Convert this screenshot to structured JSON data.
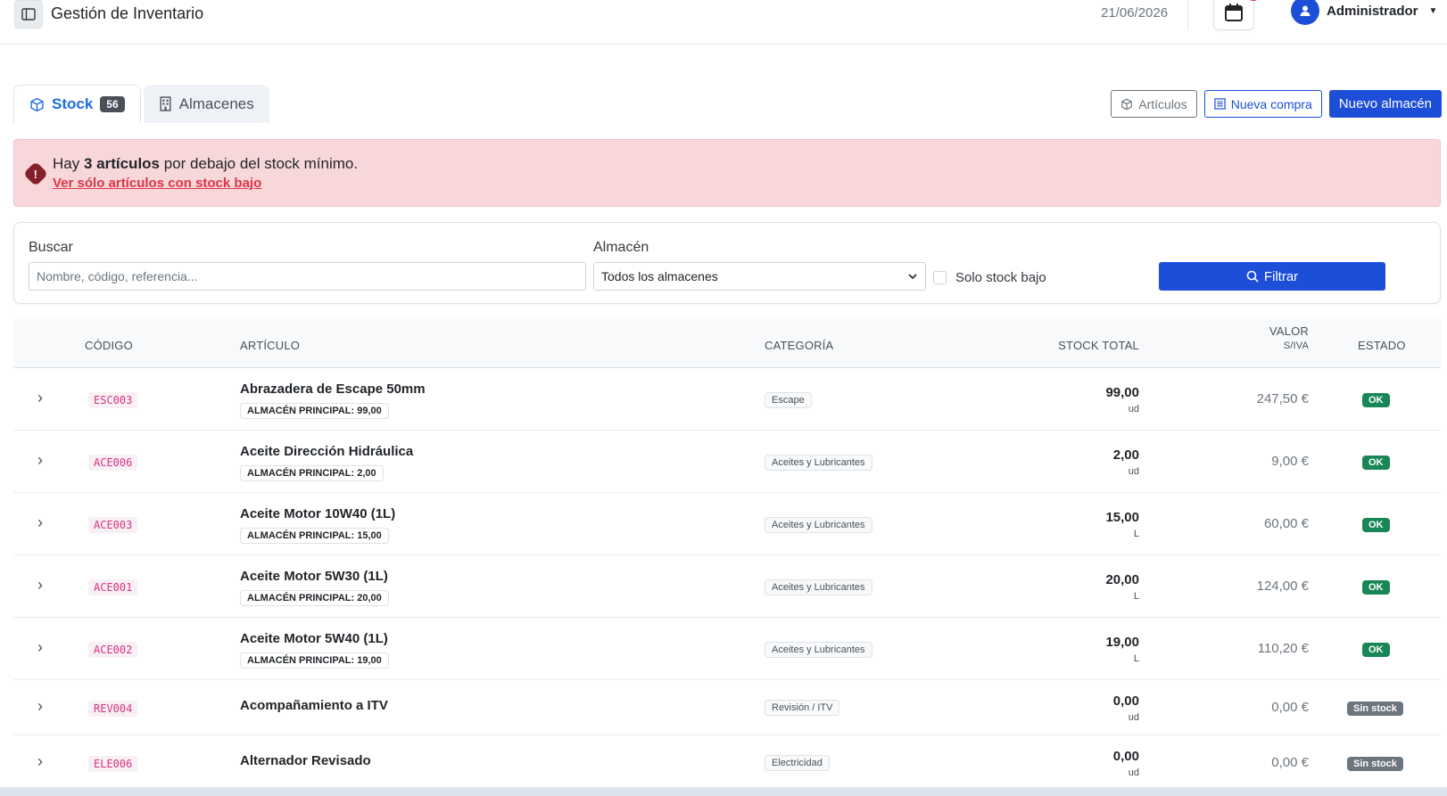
{
  "header": {
    "title": "Gestión de Inventario",
    "date": "21/06/2026",
    "user": "Administrador"
  },
  "tabs": [
    {
      "label": "Stock",
      "count": "56"
    },
    {
      "label": "Almacenes"
    }
  ],
  "actions": {
    "articulos": "Artículos",
    "nueva_compra": "Nueva compra",
    "nuevo_almacen": "Nuevo almacén"
  },
  "alert": {
    "prefix": "Hay",
    "bold": "3 artículos",
    "suffix": "por debajo del stock mínimo.",
    "link": "Ver sólo artículos con stock bajo"
  },
  "filters": {
    "search_label": "Buscar",
    "search_placeholder": "Nombre, código, referencia...",
    "warehouse_label": "Almacén",
    "warehouse_value": "Todos los almacenes",
    "low_stock_label": "Solo stock bajo",
    "filter_button": "Filtrar"
  },
  "table": {
    "columns": {
      "code": "CÓDIGO",
      "article": "ARTÍCULO",
      "category": "CATEGORÍA",
      "stock": "STOCK TOTAL",
      "value_line1": "VALOR",
      "value_line2": "S/IVA",
      "status": "ESTADO"
    },
    "rows": [
      {
        "code": "ESC003",
        "name": "Abrazadera de Escape 50mm",
        "warehouse": "ALMACÉN PRINCIPAL: 99,00",
        "category": "Escape",
        "stock": "99,00",
        "unit": "ud",
        "value": "247,50 €",
        "status": "OK"
      },
      {
        "code": "ACE006",
        "name": "Aceite Dirección Hidráulica",
        "warehouse": "ALMACÉN PRINCIPAL: 2,00",
        "category": "Aceites y Lubricantes",
        "stock": "2,00",
        "unit": "ud",
        "value": "9,00 €",
        "status": "OK"
      },
      {
        "code": "ACE003",
        "name": "Aceite Motor 10W40 (1L)",
        "warehouse": "ALMACÉN PRINCIPAL: 15,00",
        "category": "Aceites y Lubricantes",
        "stock": "15,00",
        "unit": "L",
        "value": "60,00 €",
        "status": "OK"
      },
      {
        "code": "ACE001",
        "name": "Aceite Motor 5W30 (1L)",
        "warehouse": "ALMACÉN PRINCIPAL: 20,00",
        "category": "Aceites y Lubricantes",
        "stock": "20,00",
        "unit": "L",
        "value": "124,00 €",
        "status": "OK"
      },
      {
        "code": "ACE002",
        "name": "Aceite Motor 5W40 (1L)",
        "warehouse": "ALMACÉN PRINCIPAL: 19,00",
        "category": "Aceites y Lubricantes",
        "stock": "19,00",
        "unit": "L",
        "value": "110,20 €",
        "status": "OK"
      },
      {
        "code": "REV004",
        "name": "Acompañamiento a ITV",
        "warehouse": "",
        "category": "Revisión / ITV",
        "stock": "0,00",
        "unit": "ud",
        "value": "0,00 €",
        "status": "Sin stock"
      },
      {
        "code": "ELE006",
        "name": "Alternador Revisado",
        "warehouse": "",
        "category": "Electricidad",
        "stock": "0,00",
        "unit": "ud",
        "value": "0,00 €",
        "status": "Sin stock"
      }
    ]
  },
  "icons": {
    "sidebar_toggle": "sidebar-toggle-icon",
    "calendar": "calendar-icon",
    "user": "user-icon",
    "box": "box-icon",
    "building": "building-icon",
    "alert": "alert-octagon-icon",
    "search": "search-icon",
    "chevron_right": "chevron-right-icon"
  },
  "colors": {
    "primary": "#1d4ed8",
    "danger": "#dc3545",
    "success": "#198754",
    "muted": "#6c757d"
  }
}
